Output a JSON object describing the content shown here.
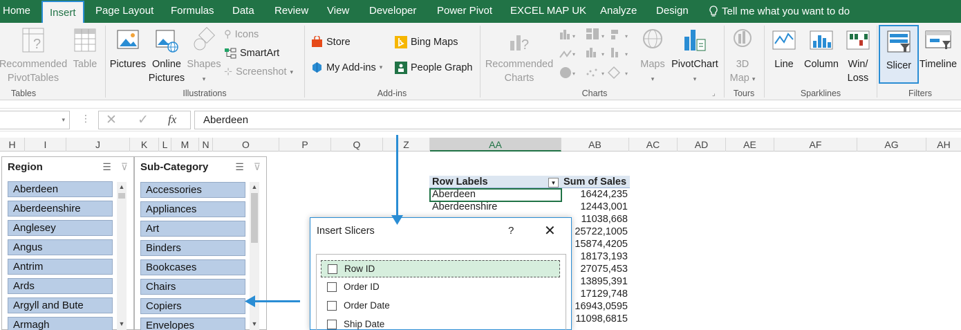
{
  "tabs": [
    {
      "label": "Home",
      "active": false
    },
    {
      "label": "Insert",
      "active": true
    },
    {
      "label": "Page Layout",
      "active": false
    },
    {
      "label": "Formulas",
      "active": false
    },
    {
      "label": "Data",
      "active": false
    },
    {
      "label": "Review",
      "active": false
    },
    {
      "label": "View",
      "active": false
    },
    {
      "label": "Developer",
      "active": false
    },
    {
      "label": "Power Pivot",
      "active": false
    },
    {
      "label": "EXCEL MAP UK",
      "active": false
    },
    {
      "label": "Analyze",
      "active": false
    },
    {
      "label": "Design",
      "active": false
    }
  ],
  "tell_me": "Tell me what you want to do",
  "ribbon": {
    "tables": {
      "group_label": "Tables",
      "recommended_pivot": [
        "Recommended",
        "PivotTables"
      ],
      "table": "Table"
    },
    "illustrations": {
      "group_label": "Illustrations",
      "pictures": "Pictures",
      "online_pictures": [
        "Online",
        "Pictures"
      ],
      "shapes": "Shapes",
      "icons": "Icons",
      "smartart": "SmartArt",
      "screenshot": "Screenshot"
    },
    "addins": {
      "group_label": "Add-ins",
      "store": "Store",
      "my_addins": "My Add-ins",
      "bing_maps": "Bing Maps",
      "people_graph": "People Graph"
    },
    "charts": {
      "group_label": "Charts",
      "recommended_charts": [
        "Recommended",
        "Charts"
      ],
      "maps": "Maps",
      "pivotchart": "PivotChart"
    },
    "tours": {
      "group_label": "Tours",
      "map3d": [
        "3D",
        "Map"
      ]
    },
    "sparklines": {
      "group_label": "Sparklines",
      "line": "Line",
      "column": "Column",
      "winloss": [
        "Win/",
        "Loss"
      ]
    },
    "filters": {
      "group_label": "Filters",
      "slicer": "Slicer",
      "timeline": "Timeline"
    }
  },
  "formula_bar": {
    "fx": "fx",
    "value": "Aberdeen"
  },
  "columns": [
    "H",
    "I",
    "J",
    "K",
    "L",
    "M",
    "N",
    "O",
    "P",
    "Q",
    "Z",
    "AA",
    "AB",
    "AC",
    "AD",
    "AE",
    "AF",
    "AG",
    "AH"
  ],
  "slicers": [
    {
      "title": "Region",
      "items": [
        "Aberdeen",
        "Aberdeenshire",
        "Anglesey",
        "Angus",
        "Antrim",
        "Ards",
        "Argyll and Bute",
        "Armagh"
      ]
    },
    {
      "title": "Sub-Category",
      "items": [
        "Accessories",
        "Appliances",
        "Art",
        "Binders",
        "Bookcases",
        "Chairs",
        "Copiers",
        "Envelopes"
      ]
    }
  ],
  "pivot": {
    "header_labels": "Row Labels",
    "header_values": "Sum of Sales",
    "rows": [
      {
        "label": "Aberdeen",
        "value": "16424,235"
      },
      {
        "label": "Aberdeenshire",
        "value": "12443,001"
      },
      {
        "label": "",
        "value": "11038,668"
      },
      {
        "label": "",
        "value": "25722,1005"
      },
      {
        "label": "",
        "value": "15874,4205"
      },
      {
        "label": "",
        "value": "18173,193"
      },
      {
        "label": "",
        "value": "27075,453"
      },
      {
        "label": "",
        "value": "13895,391"
      },
      {
        "label": "",
        "value": "17129,748"
      },
      {
        "label": "",
        "value": "16943,0595"
      },
      {
        "label": "",
        "value": "11098,6815"
      }
    ]
  },
  "dialog": {
    "title": "Insert Slicers",
    "help": "?",
    "close": "✕",
    "fields": [
      "Row ID",
      "Order ID",
      "Order Date",
      "Ship Date"
    ]
  },
  "colors": {
    "excel_green": "#217346",
    "accent_blue": "#2a8dd4",
    "slicer_item": "#b9cde6"
  }
}
